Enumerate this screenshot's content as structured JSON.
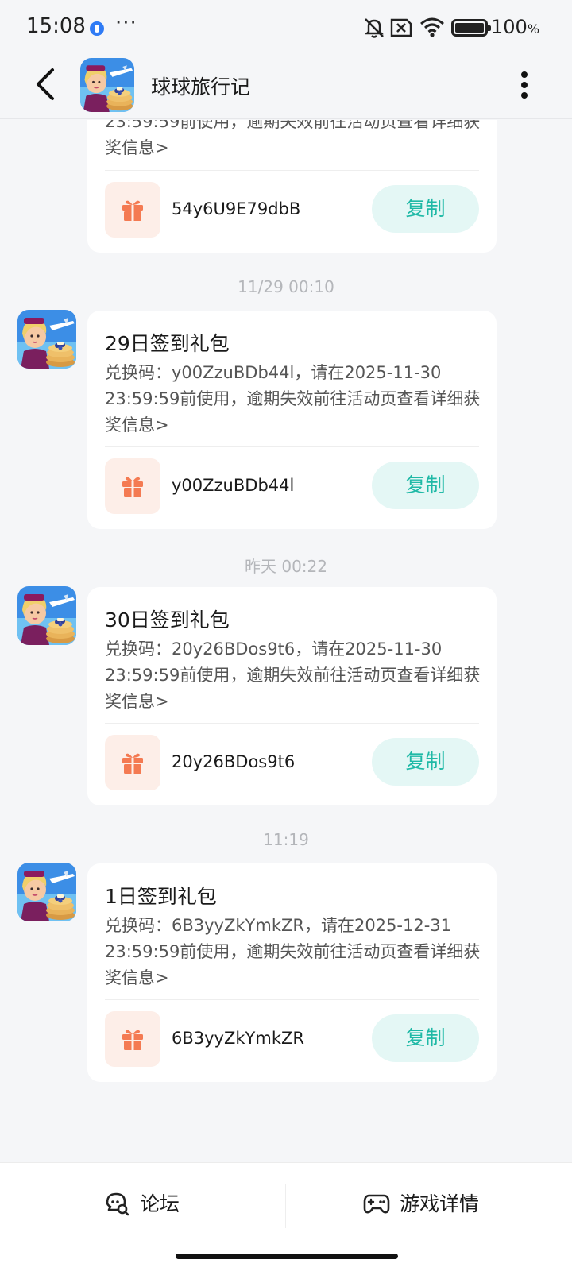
{
  "status_bar": {
    "time": "15:08",
    "more": "···",
    "battery_percent": "100",
    "battery_unit": "%"
  },
  "header": {
    "title": "球球旅行记"
  },
  "messages": [
    {
      "desc_tail": "23:59:59前使用，逾期失效前往活动页查看详细获奖信息>",
      "code": "54y6U9E79dbB",
      "copy_label": "复制"
    },
    {
      "timestamp": "11/29  00:10",
      "title": "29日签到礼包",
      "desc": "兑换码：y00ZzuBDb44l，请在2025-11-30 23:59:59前使用，逾期失效前往活动页查看详细获奖信息>",
      "code": "y00ZzuBDb44l",
      "copy_label": "复制"
    },
    {
      "timestamp": "昨天  00:22",
      "title": "30日签到礼包",
      "desc": "兑换码：20y26BDos9t6，请在2025-11-30 23:59:59前使用，逾期失效前往活动页查看详细获奖信息>",
      "code": "20y26BDos9t6",
      "copy_label": "复制"
    },
    {
      "timestamp": "11:19",
      "title": "1日签到礼包",
      "desc": "兑换码：6B3yyZkYmkZR，请在2025-12-31 23:59:59前使用，逾期失效前往活动页查看详细获奖信息>",
      "code": "6B3yyZkYmkZR",
      "copy_label": "复制"
    }
  ],
  "bottom_bar": {
    "forum_label": "论坛",
    "game_label": "游戏详情"
  },
  "colors": {
    "accent": "#1fb9a6",
    "gift": "#f47a52",
    "background": "#f5f6f8"
  }
}
